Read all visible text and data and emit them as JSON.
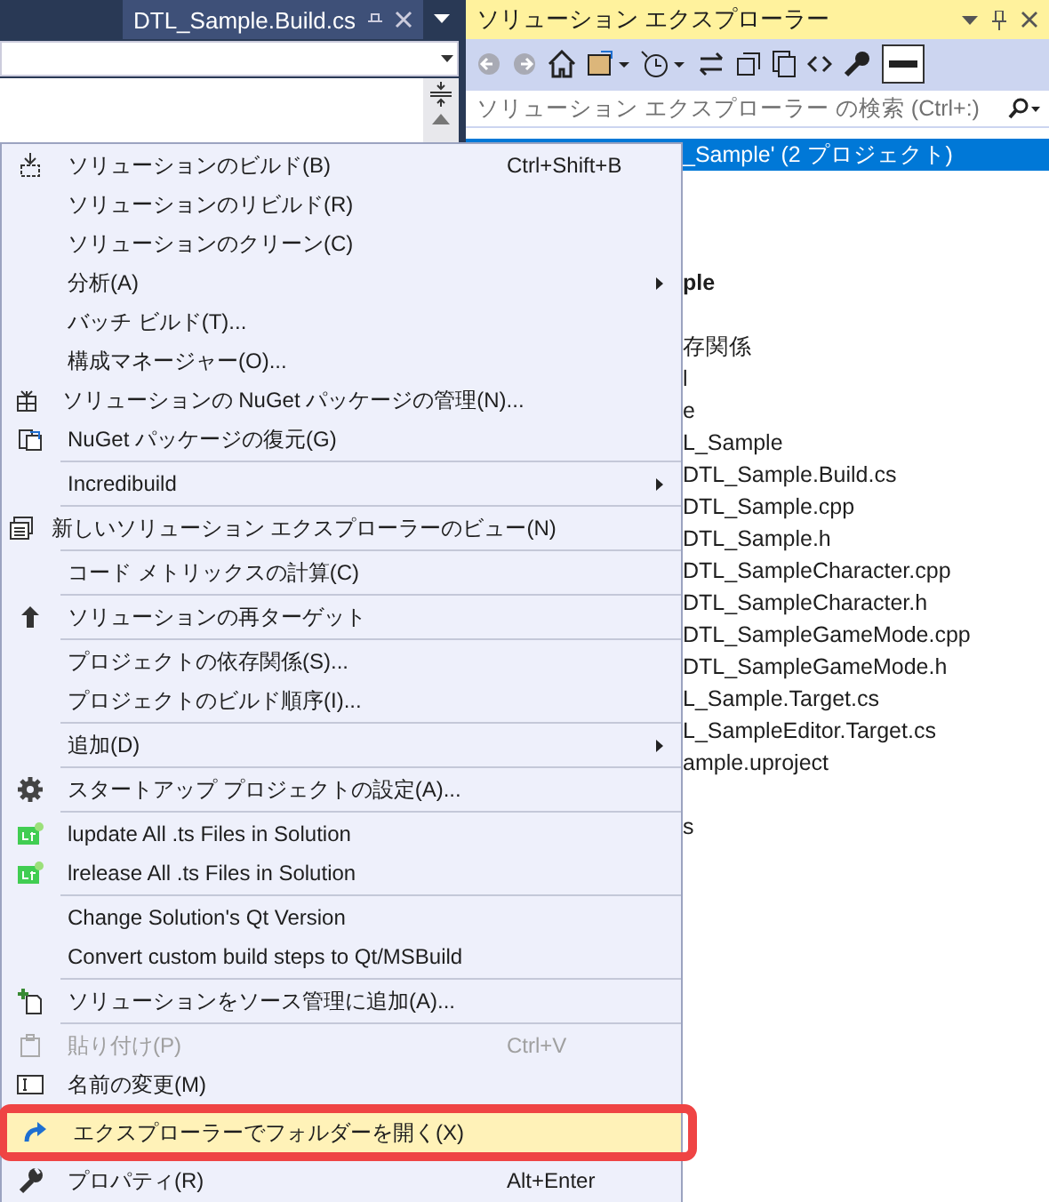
{
  "editor": {
    "tab": {
      "title": "DTL_Sample.Build.cs",
      "selected": true
    }
  },
  "solution_explorer": {
    "title": "ソリューション エクスプローラー",
    "search": {
      "placeholder": "ソリューション エクスプローラー の検索 (Ctrl+:)"
    },
    "tree": [
      {
        "kind": "row",
        "text": "_Sample' (2 プロジェクト)",
        "selected": true,
        "bold": false
      },
      {
        "kind": "covered"
      },
      {
        "kind": "covered"
      },
      {
        "kind": "covered"
      },
      {
        "kind": "row",
        "text": "ple",
        "selected": false,
        "bold": true
      },
      {
        "kind": "covered"
      },
      {
        "kind": "row",
        "text": "存関係",
        "selected": false,
        "bold": false
      },
      {
        "kind": "row",
        "text": "l",
        "selected": false,
        "bold": false
      },
      {
        "kind": "row",
        "text": "e",
        "selected": false,
        "bold": false
      },
      {
        "kind": "row",
        "text": "L_Sample",
        "selected": false,
        "bold": false
      },
      {
        "kind": "row",
        "text": "DTL_Sample.Build.cs",
        "selected": false,
        "bold": false
      },
      {
        "kind": "row",
        "text": "DTL_Sample.cpp",
        "selected": false,
        "bold": false
      },
      {
        "kind": "row",
        "text": "DTL_Sample.h",
        "selected": false,
        "bold": false
      },
      {
        "kind": "row",
        "text": "DTL_SampleCharacter.cpp",
        "selected": false,
        "bold": false
      },
      {
        "kind": "row",
        "text": "DTL_SampleCharacter.h",
        "selected": false,
        "bold": false
      },
      {
        "kind": "row",
        "text": "DTL_SampleGameMode.cpp",
        "selected": false,
        "bold": false
      },
      {
        "kind": "row",
        "text": "DTL_SampleGameMode.h",
        "selected": false,
        "bold": false
      },
      {
        "kind": "row",
        "text": "L_Sample.Target.cs",
        "selected": false,
        "bold": false
      },
      {
        "kind": "row",
        "text": "L_SampleEditor.Target.cs",
        "selected": false,
        "bold": false
      },
      {
        "kind": "row",
        "text": "ample.uproject",
        "selected": false,
        "bold": false
      },
      {
        "kind": "covered"
      },
      {
        "kind": "row",
        "text": "s",
        "selected": false,
        "bold": false
      }
    ]
  },
  "context_menu": {
    "groups": [
      [
        {
          "label": "ソリューションのビルド(B)",
          "shortcut": "Ctrl+Shift+B",
          "submenu": false,
          "disabled": false,
          "selected": false
        },
        {
          "label": "ソリューションのリビルド(R)",
          "submenu": false,
          "disabled": false,
          "selected": false
        },
        {
          "label": "ソリューションのクリーン(C)",
          "submenu": false,
          "disabled": false,
          "selected": false
        },
        {
          "label": "分析(A)",
          "submenu": true,
          "disabled": false,
          "selected": false
        },
        {
          "label": "バッチ ビルド(T)...",
          "submenu": false,
          "disabled": false,
          "selected": false
        },
        {
          "label": "構成マネージャー(O)...",
          "submenu": false,
          "disabled": false,
          "selected": false
        },
        {
          "label": "ソリューションの NuGet パッケージの管理(N)...",
          "submenu": false,
          "disabled": false,
          "selected": false
        },
        {
          "label": "NuGet パッケージの復元(G)",
          "submenu": false,
          "disabled": false,
          "selected": false
        }
      ],
      [
        {
          "label": "Incredibuild",
          "submenu": true,
          "disabled": false,
          "selected": false
        }
      ],
      [
        {
          "label": "新しいソリューション エクスプローラーのビュー(N)",
          "submenu": false,
          "disabled": false,
          "selected": false
        }
      ],
      [
        {
          "label": "コード メトリックスの計算(C)",
          "submenu": false,
          "disabled": false,
          "selected": false
        }
      ],
      [
        {
          "label": "ソリューションの再ターゲット",
          "submenu": false,
          "disabled": false,
          "selected": false
        }
      ],
      [
        {
          "label": "プロジェクトの依存関係(S)...",
          "submenu": false,
          "disabled": false,
          "selected": false
        },
        {
          "label": "プロジェクトのビルド順序(I)...",
          "submenu": false,
          "disabled": false,
          "selected": false
        }
      ],
      [
        {
          "label": "追加(D)",
          "submenu": true,
          "disabled": false,
          "selected": false
        }
      ],
      [
        {
          "label": "スタートアップ プロジェクトの設定(A)...",
          "submenu": false,
          "disabled": false,
          "selected": false
        }
      ],
      [
        {
          "label": "lupdate All .ts Files in Solution",
          "submenu": false,
          "disabled": false,
          "selected": false
        },
        {
          "label": "lrelease All .ts Files in Solution",
          "submenu": false,
          "disabled": false,
          "selected": false
        }
      ],
      [
        {
          "label": "Change Solution's Qt Version",
          "submenu": false,
          "disabled": false,
          "selected": false
        },
        {
          "label": "Convert custom build steps to Qt/MSBuild",
          "submenu": false,
          "disabled": false,
          "selected": false
        }
      ],
      [
        {
          "label": "ソリューションをソース管理に追加(A)...",
          "submenu": false,
          "disabled": false,
          "selected": false
        }
      ],
      [
        {
          "label": "貼り付け(P)",
          "shortcut": "Ctrl+V",
          "submenu": false,
          "disabled": true,
          "selected": false
        },
        {
          "label": "名前の変更(M)",
          "submenu": false,
          "disabled": false,
          "selected": false
        },
        {
          "label": "エクスプローラーでフォルダーを開く(X)",
          "submenu": false,
          "disabled": false,
          "selected": true,
          "callout": true
        },
        {
          "label": "プロパティ(R)",
          "shortcut": "Alt+Enter",
          "submenu": false,
          "disabled": false,
          "selected": false
        }
      ]
    ]
  }
}
